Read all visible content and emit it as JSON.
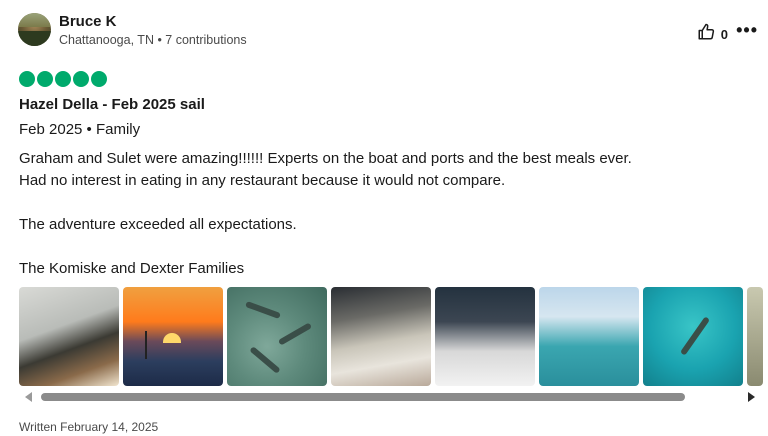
{
  "review": {
    "user": {
      "name": "Bruce K",
      "meta": "Chattanooga, TN • 7 contributions"
    },
    "helpful_count": "0",
    "more_label": "•••",
    "rating": 5,
    "rating_color": "#00aa6c",
    "title": "Hazel Della - Feb 2025 sail",
    "trip": "Feb 2025 • Family",
    "paragraphs": [
      "Graham and Sulet were amazing!!!!!! Experts on the boat and ports and the best meals ever.",
      "Had no interest in eating in any restaurant because it would not compare.",
      "The adventure exceeded all expectations.",
      "The Komiske and Dexter Families"
    ],
    "photos_count_visible": 8,
    "written": "Written February 14, 2025"
  },
  "icons": {
    "helpful": "thumbs-up-icon",
    "more": "more-options-icon",
    "scroll_left": "chevron-left-icon",
    "scroll_right": "chevron-right-icon"
  }
}
